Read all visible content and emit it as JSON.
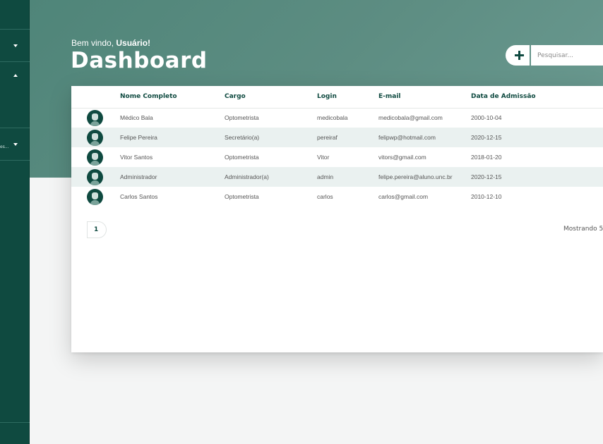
{
  "header": {
    "welcome_prefix": "Bem vindo, ",
    "welcome_user": "Usuário!",
    "title": "Dashboard",
    "search_placeholder": "Pesquisar..."
  },
  "sidebar": {
    "truncated_label": "es..."
  },
  "table": {
    "columns": [
      "Nome Completo",
      "Cargo",
      "Login",
      "E-mail",
      "Data de Admissão"
    ],
    "rows": [
      {
        "name": "Médico Bala",
        "cargo": "Optometrista",
        "login": "medicobala",
        "email": "medicobala@gmail.com",
        "data": "2000-10-04"
      },
      {
        "name": "Felipe Pereira",
        "cargo": "Secretário(a)",
        "login": "pereiraf",
        "email": "felipwp@hotmail.com",
        "data": "2020-12-15"
      },
      {
        "name": "Vitor Santos",
        "cargo": "Optometrista",
        "login": "Vitor",
        "email": "vitors@gmail.com",
        "data": "2018-01-20"
      },
      {
        "name": "Administrador",
        "cargo": "Administrador(a)",
        "login": "admin",
        "email": "felipe.pereira@aluno.unc.br",
        "data": "2020-12-15"
      },
      {
        "name": "Carlos Santos",
        "cargo": "Optometrista",
        "login": "carlos",
        "email": "carlos@gmail.com",
        "data": "2010-12-10"
      }
    ]
  },
  "pagination": {
    "current_page": "1",
    "showing_text": "Mostrando 5"
  },
  "colors": {
    "primary": "#0f4a40",
    "header": "#5d8d82",
    "row_alt": "#eaf1f0"
  }
}
